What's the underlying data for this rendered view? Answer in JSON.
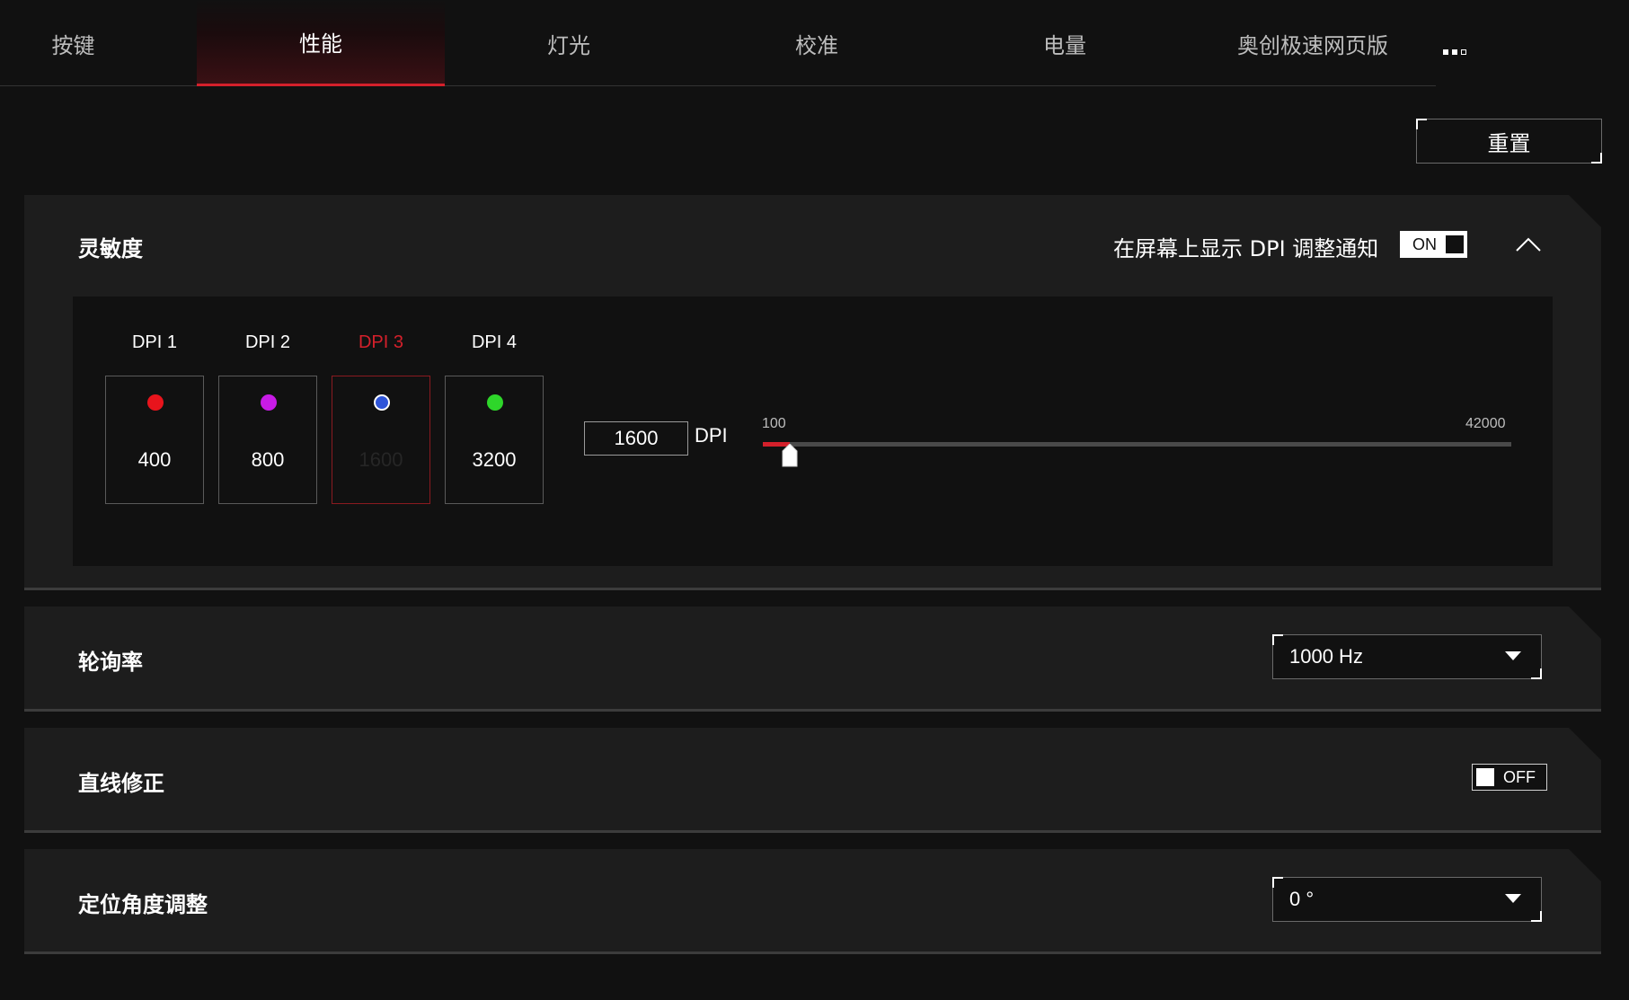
{
  "tabs": [
    {
      "label": "按键"
    },
    {
      "label": "性能"
    },
    {
      "label": "灯光"
    },
    {
      "label": "校准"
    },
    {
      "label": "电量"
    },
    {
      "label": "奥创极速网页版"
    }
  ],
  "active_tab_index": 1,
  "more_icon": "more-dots-icon",
  "reset_label": "重置",
  "sensitivity": {
    "title": "灵敏度",
    "notify_label": "在屏幕上显示 DPI 调整通知",
    "notify_toggle": "ON",
    "collapse_icon": "chevron-up-icon",
    "levels": [
      {
        "label": "DPI 1",
        "value": "400",
        "color": "#e8141c"
      },
      {
        "label": "DPI 2",
        "value": "800",
        "color": "#c81be6"
      },
      {
        "label": "DPI 3",
        "value": "1600",
        "color": "#2f55d9"
      },
      {
        "label": "DPI 4",
        "value": "3200",
        "color": "#2ed62a"
      }
    ],
    "active_level_index": 2,
    "current_value": "1600",
    "unit": "DPI",
    "slider_min": "100",
    "slider_max": "42000",
    "slider_value": 1600
  },
  "polling_rate": {
    "title": "轮询率",
    "value": "1000 Hz"
  },
  "angle_snapping": {
    "title": "直线修正",
    "toggle": "OFF"
  },
  "angle_tuning": {
    "title": "定位角度调整",
    "value": "0 °"
  },
  "colors": {
    "accent": "#d4202b",
    "background": "#111111",
    "panel": "#1d1d1d"
  }
}
